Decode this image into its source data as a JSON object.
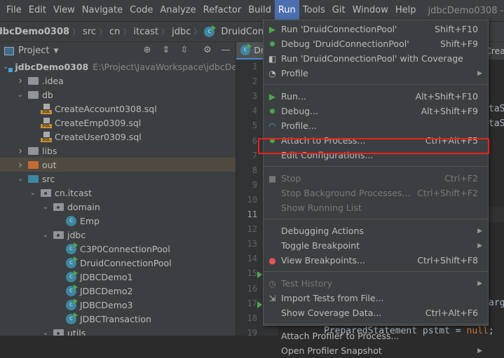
{
  "menubar": {
    "items": [
      "File",
      "Edit",
      "View",
      "Navigate",
      "Code",
      "Analyze",
      "Refactor",
      "Build",
      "Run",
      "Tools",
      "Git",
      "Window",
      "Help"
    ],
    "active": "Run",
    "window_title": "jdbcDemo0308 - Dr"
  },
  "breadcrumb": [
    "jdbcDemo0308",
    "src",
    "cn",
    "itcast",
    "jdbc",
    "DruidConnectionPoo"
  ],
  "project_panel": {
    "title": "Project",
    "tree": [
      {
        "label": "jdbcDemo0308",
        "path": "E:\\Project\\JavaWorkspace\\jdbcDe"
      },
      {
        "label": ".idea"
      },
      {
        "label": "db"
      },
      {
        "label": "CreateAccount0308.sql"
      },
      {
        "label": "CreateEmp0309.sql"
      },
      {
        "label": "CreateUser0309.sql"
      },
      {
        "label": "libs"
      },
      {
        "label": "out"
      },
      {
        "label": "src"
      },
      {
        "label": "cn.itcast"
      },
      {
        "label": "domain"
      },
      {
        "label": "Emp"
      },
      {
        "label": "jdbc"
      },
      {
        "label": "C3P0ConnectionPool"
      },
      {
        "label": "DruidConnectionPool"
      },
      {
        "label": "JDBCDemo1"
      },
      {
        "label": "JDBCDemo2"
      },
      {
        "label": "JDBCDemo3"
      },
      {
        "label": "JDBCTransaction"
      },
      {
        "label": "utils"
      }
    ]
  },
  "editor": {
    "tabs": [
      "Dr",
      "Creat"
    ],
    "line_numbers": [
      "1",
      "2",
      "3",
      "4",
      "5",
      "6",
      "7",
      "8",
      "9",
      "10",
      "11",
      "12",
      "13",
      "14",
      "15",
      "16",
      "17",
      "18",
      "19"
    ],
    "current_line": "11",
    "code_fragments": {
      "l4": "taS",
      "l5": "taS",
      "l17": "arg",
      "l19_a": "PreparedStatement pstmt = ",
      "l19_b": "null",
      ";": ";"
    }
  },
  "run_menu": {
    "items": [
      {
        "label": "Run 'DruidConnectionPool'",
        "shortcut": "Shift+F10",
        "icon": "run-icon"
      },
      {
        "label": "Debug 'DruidConnectionPool'",
        "shortcut": "Shift+F9",
        "icon": "debug-icon"
      },
      {
        "label": "Run 'DruidConnectionPool' with Coverage",
        "shortcut": "",
        "icon": "coverage-icon"
      },
      {
        "label": "Profile",
        "shortcut": "",
        "icon": "profile-icon",
        "submenu": true
      },
      {
        "label": "Run...",
        "shortcut": "Alt+Shift+F10",
        "icon": "run-icon"
      },
      {
        "label": "Debug...",
        "shortcut": "Alt+Shift+F9",
        "icon": "debug-icon"
      },
      {
        "label": "Profile...",
        "shortcut": "",
        "icon": "profiler-gauge-icon"
      },
      {
        "label": "Attach to Process...",
        "shortcut": "Ctrl+Alt+F5",
        "icon": "attach-debug-icon"
      },
      {
        "label": "Edit Configurations...",
        "shortcut": "",
        "highlighted": true
      },
      {
        "label": "Stop",
        "shortcut": "Ctrl+F2",
        "icon": "stop-icon",
        "disabled": true
      },
      {
        "label": "Stop Background Processes...",
        "shortcut": "Ctrl+Shift+F2",
        "disabled": true
      },
      {
        "label": "Show Running List",
        "shortcut": "",
        "disabled": true
      },
      {
        "label": "Debugging Actions",
        "shortcut": "",
        "submenu": true
      },
      {
        "label": "Toggle Breakpoint",
        "shortcut": "",
        "submenu": true
      },
      {
        "label": "View Breakpoints...",
        "shortcut": "Ctrl+Shift+F8",
        "icon": "breakpoints-icon"
      },
      {
        "label": "Test History",
        "shortcut": "",
        "icon": "clock-icon",
        "disabled": true,
        "submenu": true
      },
      {
        "label": "Import Tests from File...",
        "shortcut": "",
        "icon": "import-icon"
      },
      {
        "label": "Show Coverage Data...",
        "shortcut": "Ctrl+Alt+F6"
      },
      {
        "label": "Attach Profiler to Process...",
        "shortcut": ""
      },
      {
        "label": "Open Profiler Snapshot",
        "shortcut": "",
        "submenu": true
      }
    ]
  },
  "colors": {
    "accent": "#4b6eaf",
    "highlight_box": "#e8231c",
    "run_green": "#4fa84f"
  }
}
